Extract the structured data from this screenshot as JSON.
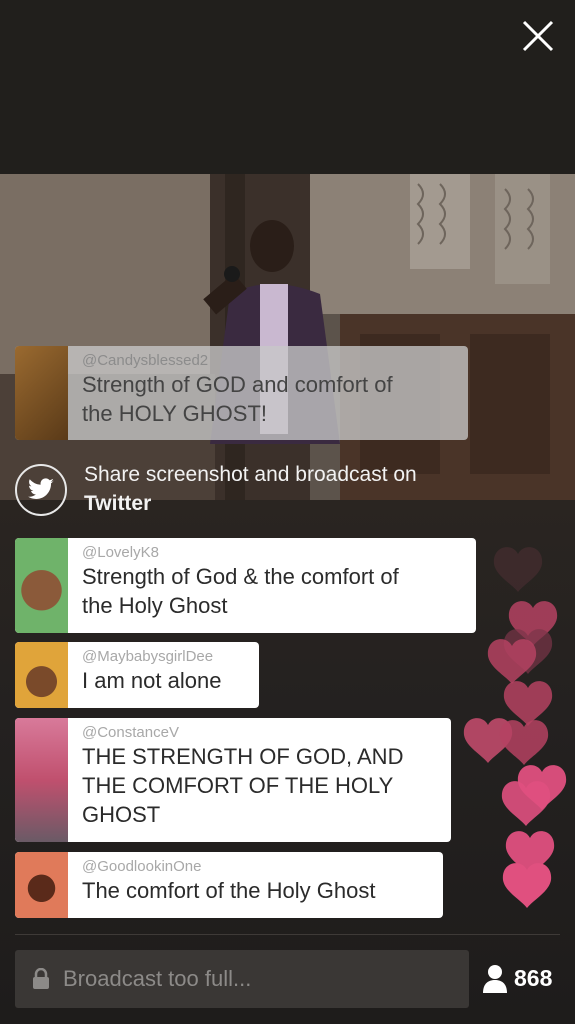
{
  "header": {
    "close_icon": "close-icon"
  },
  "video": {
    "description_icon": "live-video"
  },
  "comments": [
    {
      "user": "@Candysblessed2",
      "message_line1": "Strength of GOD and comfort of",
      "message_line2": "the HOLY GHOST!",
      "style": "ghost"
    },
    {
      "user": "@LovelyK8",
      "message_line1": "Strength of God & the comfort of",
      "message_line2": "the Holy Ghost",
      "style": "white"
    },
    {
      "user": "@MaybabysgirlDee",
      "message_line1": "I am not alone",
      "style": "white"
    },
    {
      "user": "@ConstanceV",
      "message_line1": "THE STRENGTH OF GOD, AND",
      "message_line2": "THE COMFORT OF THE HOLY",
      "message_line3": "GHOST",
      "style": "white"
    },
    {
      "user": "@GoodlookinOne",
      "message_line1": "The comfort of the Holy Ghost",
      "style": "white"
    }
  ],
  "share": {
    "text": "Share screenshot and broadcast on",
    "service": "Twitter",
    "icon": "twitter-icon"
  },
  "input": {
    "placeholder": "Broadcast too full...",
    "icon": "lock-icon"
  },
  "viewers": {
    "count": "868",
    "icon": "person-icon"
  },
  "colors": {
    "heart_pink": "#e0507f",
    "heart_dark": "#a23a55",
    "white_card": "#ffffff"
  }
}
